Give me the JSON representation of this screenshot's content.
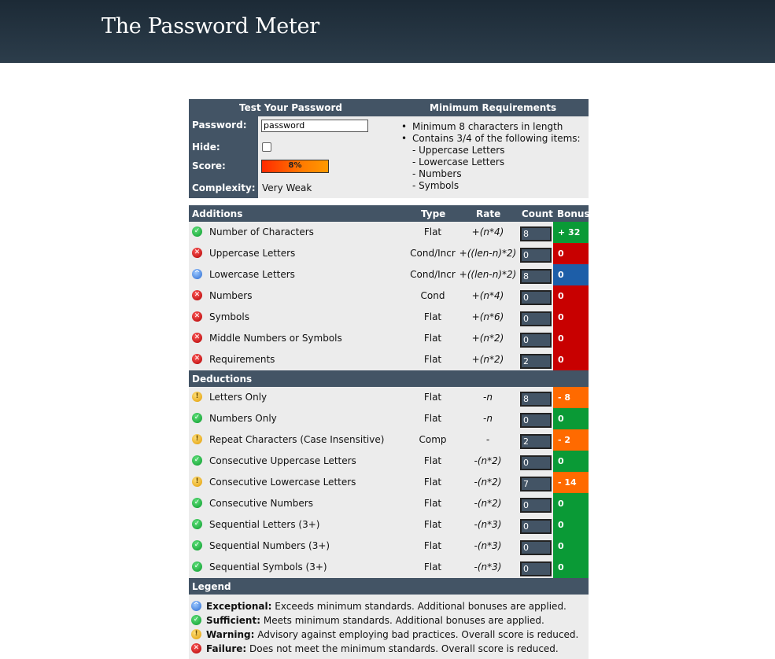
{
  "header": {
    "title": "The Password Meter"
  },
  "test": {
    "heading": "Test Your Password",
    "password_label": "Password:",
    "password_value": "password",
    "hide_label": "Hide:",
    "score_label": "Score:",
    "score_value": "8%",
    "score_fraction": 0.08,
    "complexity_label": "Complexity:",
    "complexity_value": "Very Weak"
  },
  "requirements": {
    "heading": "Minimum Requirements",
    "bullets": [
      "Minimum 8 characters in length",
      "Contains 3/4 of the following items:"
    ],
    "subitems": [
      "- Uppercase Letters",
      "- Lowercase Letters",
      "- Numbers",
      "- Symbols"
    ]
  },
  "additions": {
    "heading": "Additions",
    "col_type": "Type",
    "col_rate": "Rate",
    "col_count": "Count",
    "col_bonus": "Bonus",
    "rows": [
      {
        "status": "ok",
        "name": "Number of Characters",
        "type": "Flat",
        "rate": "+(n*4)",
        "count": "8",
        "bonus": "+ 32",
        "color": "green"
      },
      {
        "status": "fail",
        "name": "Uppercase Letters",
        "type": "Cond/Incr",
        "rate": "+((len-n)*2)",
        "count": "0",
        "bonus": "0",
        "color": "red"
      },
      {
        "status": "exc",
        "name": "Lowercase Letters",
        "type": "Cond/Incr",
        "rate": "+((len-n)*2)",
        "count": "8",
        "bonus": "0",
        "color": "blue"
      },
      {
        "status": "fail",
        "name": "Numbers",
        "type": "Cond",
        "rate": "+(n*4)",
        "count": "0",
        "bonus": "0",
        "color": "red"
      },
      {
        "status": "fail",
        "name": "Symbols",
        "type": "Flat",
        "rate": "+(n*6)",
        "count": "0",
        "bonus": "0",
        "color": "red"
      },
      {
        "status": "fail",
        "name": "Middle Numbers or Symbols",
        "type": "Flat",
        "rate": "+(n*2)",
        "count": "0",
        "bonus": "0",
        "color": "red"
      },
      {
        "status": "fail",
        "name": "Requirements",
        "type": "Flat",
        "rate": "+(n*2)",
        "count": "2",
        "bonus": "0",
        "color": "red"
      }
    ]
  },
  "deductions": {
    "heading": "Deductions",
    "rows": [
      {
        "status": "warn",
        "name": "Letters Only",
        "type": "Flat",
        "rate": "-n",
        "count": "8",
        "bonus": "- 8",
        "color": "orange"
      },
      {
        "status": "ok",
        "name": "Numbers Only",
        "type": "Flat",
        "rate": "-n",
        "count": "0",
        "bonus": "0",
        "color": "green"
      },
      {
        "status": "warn",
        "name": "Repeat Characters (Case Insensitive)",
        "type": "Comp",
        "rate": "-",
        "count": "2",
        "bonus": "- 2",
        "color": "orange"
      },
      {
        "status": "ok",
        "name": "Consecutive Uppercase Letters",
        "type": "Flat",
        "rate": "-(n*2)",
        "count": "0",
        "bonus": "0",
        "color": "green"
      },
      {
        "status": "warn",
        "name": "Consecutive Lowercase Letters",
        "type": "Flat",
        "rate": "-(n*2)",
        "count": "7",
        "bonus": "- 14",
        "color": "orange"
      },
      {
        "status": "ok",
        "name": "Consecutive Numbers",
        "type": "Flat",
        "rate": "-(n*2)",
        "count": "0",
        "bonus": "0",
        "color": "green"
      },
      {
        "status": "ok",
        "name": "Sequential Letters (3+)",
        "type": "Flat",
        "rate": "-(n*3)",
        "count": "0",
        "bonus": "0",
        "color": "green"
      },
      {
        "status": "ok",
        "name": "Sequential Numbers (3+)",
        "type": "Flat",
        "rate": "-(n*3)",
        "count": "0",
        "bonus": "0",
        "color": "green"
      },
      {
        "status": "ok",
        "name": "Sequential Symbols (3+)",
        "type": "Flat",
        "rate": "-(n*3)",
        "count": "0",
        "bonus": "0",
        "color": "green"
      }
    ]
  },
  "legend": {
    "heading": "Legend",
    "items": [
      {
        "status": "exc",
        "term": "Exceptional:",
        "desc": "Exceeds minimum standards. Additional bonuses are applied."
      },
      {
        "status": "ok",
        "term": "Sufficient:",
        "desc": "Meets minimum standards. Additional bonuses are applied."
      },
      {
        "status": "warn",
        "term": "Warning:",
        "desc": "Advisory against employing bad practices. Overall score is reduced."
      },
      {
        "status": "fail",
        "term": "Failure:",
        "desc": "Does not meet the minimum standards. Overall score is reduced."
      }
    ]
  },
  "colors": {
    "header_bg": "#1c2a36",
    "section_bg": "#435465",
    "row_bg": "#ececec",
    "green": "#0a9a36",
    "red": "#c80000",
    "blue": "#1d5ea8",
    "orange": "#ff6a00"
  }
}
